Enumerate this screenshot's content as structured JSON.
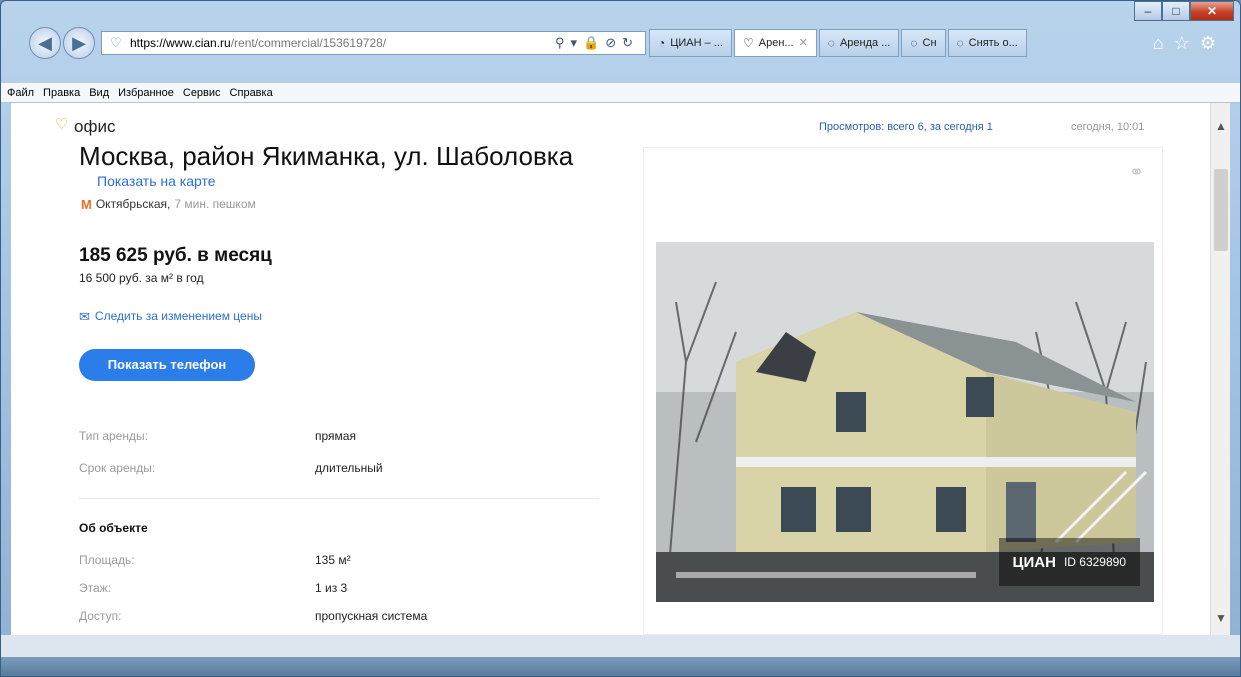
{
  "browser": {
    "address": {
      "host": "https://www.cian.ru",
      "path": "/rent/commercial/153619728/"
    },
    "tabs": [
      {
        "label": "ЦИАН – ...",
        "active": false
      },
      {
        "label": "Арен...",
        "active": true
      },
      {
        "label": "Аренда ...",
        "active": false
      },
      {
        "label": "Сн",
        "active": false
      },
      {
        "label": "Снять о...",
        "active": false
      }
    ],
    "menu": [
      "Файл",
      "Правка",
      "Вид",
      "Избранное",
      "Сервис",
      "Справка"
    ]
  },
  "listing": {
    "category": "офис",
    "views": "Просмотров: всего 6, за сегодня 1",
    "date": "сегодня, 10:01",
    "address": "Москва, район Якиманка, ул. Шаболовка",
    "map_link": "Показать на карте",
    "metro": {
      "station": "Октябрьская,",
      "time": "7 мин. пешком"
    },
    "price": "185 625 руб. в месяц",
    "price_per_m2": "16 500 руб. за м² в год",
    "follow_price": "Следить за изменением цены",
    "show_phone": "Показать телефон",
    "rent_terms": [
      {
        "label": "Тип аренды:",
        "value": "прямая"
      },
      {
        "label": "Срок аренды:",
        "value": "длительный"
      }
    ],
    "object_title": "Об объекте",
    "object_props": [
      {
        "label": "Площадь:",
        "value": "135 м²"
      },
      {
        "label": "Этаж:",
        "value": "1 из 3"
      },
      {
        "label": "Доступ:",
        "value": "пропускная система"
      }
    ],
    "watermark": {
      "logo": "ЦИАН",
      "id": "ID 6329890"
    }
  },
  "colors": {
    "accent": "#2b7de9",
    "link": "#2b6fd6",
    "metro": "#f36f21"
  }
}
